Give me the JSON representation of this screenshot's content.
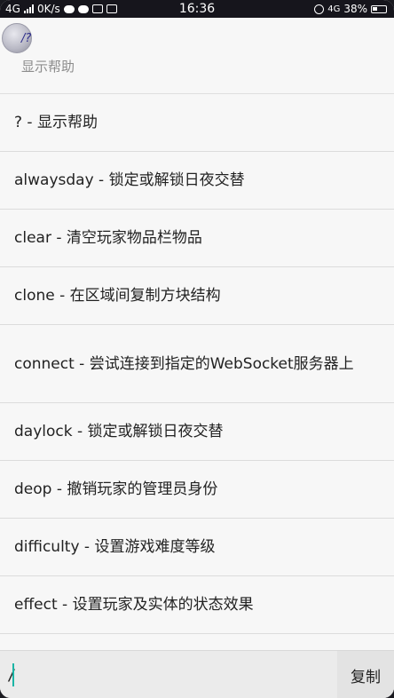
{
  "status_bar": {
    "network": "4G",
    "speed": "0K/s",
    "time": "16:36",
    "network_right": "4G",
    "battery": "38%"
  },
  "header": {
    "command": "/?",
    "subtitle": "显示帮助"
  },
  "commands": [
    {
      "text": "? - 显示帮助"
    },
    {
      "text": "alwaysday - 锁定或解锁日夜交替"
    },
    {
      "text": "clear - 清空玩家物品栏物品"
    },
    {
      "text": "clone - 在区域间复制方块结构"
    },
    {
      "text": "connect - 尝试连接到指定的WebSocket服务器上"
    },
    {
      "text": "daylock - 锁定或解锁日夜交替"
    },
    {
      "text": "deop - 撤销玩家的管理员身份"
    },
    {
      "text": "difficulty - 设置游戏难度等级"
    },
    {
      "text": "effect - 设置玩家及实体的状态效果"
    }
  ],
  "input": {
    "value": "/",
    "copy_label": "复制"
  }
}
